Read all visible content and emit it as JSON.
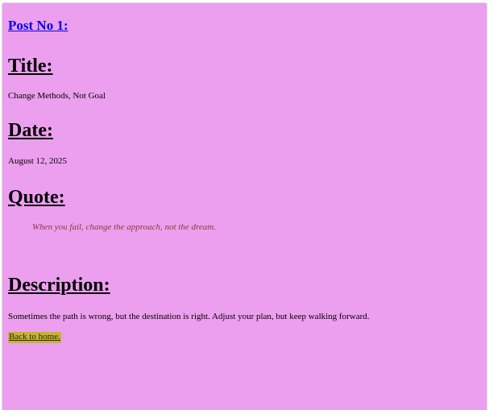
{
  "post": {
    "link_text": "Post No 1:",
    "title_heading": "Title:",
    "title_value": "Change Methods, Not Goal",
    "date_heading": "Date:",
    "date_value": "August 12, 2025",
    "quote_heading": "Quote:",
    "quote_value": "When you fail, change the approach, not the dream.",
    "description_heading": "Description:",
    "description_value": "Sometimes the path is wrong, but the destination is right. Adjust your plan, but keep walking forward.",
    "back_link_text": "Back to home."
  },
  "colors": {
    "page_background": "#ec9fee",
    "link": "#0000ee",
    "quote_text": "#8b3a3a",
    "back_link_background": "#c8b42a"
  }
}
